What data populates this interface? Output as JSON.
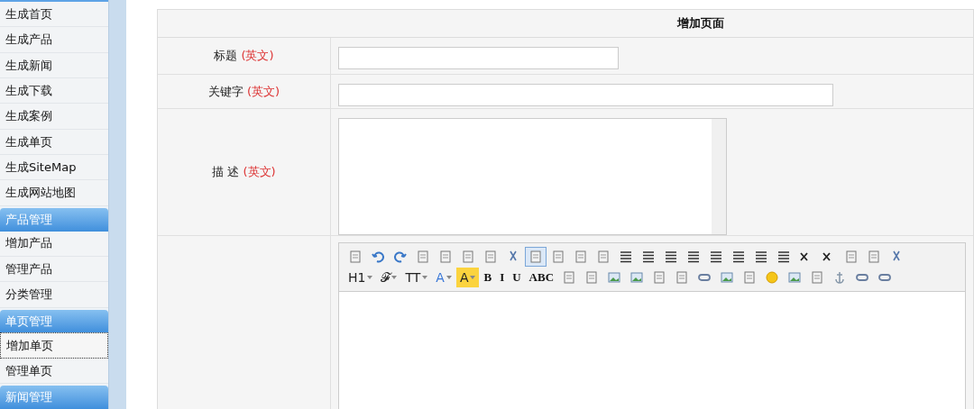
{
  "sidebar": {
    "items": [
      {
        "kind": "item",
        "label": "生成首页",
        "selected": false
      },
      {
        "kind": "item",
        "label": "生成产品",
        "selected": false
      },
      {
        "kind": "item",
        "label": "生成新闻",
        "selected": false
      },
      {
        "kind": "item",
        "label": "生成下载",
        "selected": false
      },
      {
        "kind": "item",
        "label": "生成案例",
        "selected": false
      },
      {
        "kind": "item",
        "label": "生成单页",
        "selected": false
      },
      {
        "kind": "item",
        "label": "生成SiteMap",
        "selected": false
      },
      {
        "kind": "item",
        "label": "生成网站地图",
        "selected": false
      },
      {
        "kind": "header",
        "label": "产品管理"
      },
      {
        "kind": "item",
        "label": "增加产品",
        "selected": false
      },
      {
        "kind": "item",
        "label": "管理产品",
        "selected": false
      },
      {
        "kind": "item",
        "label": "分类管理",
        "selected": false
      },
      {
        "kind": "header",
        "label": "单页管理"
      },
      {
        "kind": "item",
        "label": "增加单页",
        "selected": true
      },
      {
        "kind": "item",
        "label": "管理单页",
        "selected": false
      },
      {
        "kind": "header",
        "label": "新闻管理"
      }
    ]
  },
  "form": {
    "title": "增加页面",
    "fields": [
      {
        "kind": "short",
        "label": "标题",
        "note": "(英文)"
      },
      {
        "kind": "long",
        "label": "关键字",
        "note": "(英文)"
      },
      {
        "kind": "textarea",
        "label": "描 述",
        "note": "(英文)"
      }
    ],
    "toolbar": {
      "rows": [
        [
          {
            "kind": "icon",
            "selected": false
          },
          {
            "kind": "icon",
            "selected": false
          },
          {
            "kind": "icon",
            "selected": false
          },
          {
            "kind": "icon",
            "selected": false
          },
          {
            "kind": "icon",
            "selected": false
          },
          {
            "kind": "icon",
            "selected": false
          },
          {
            "kind": "icon",
            "selected": false
          },
          {
            "kind": "icon",
            "selected": false
          },
          {
            "kind": "icon",
            "selected": true
          },
          {
            "kind": "icon",
            "selected": false
          },
          {
            "kind": "icon",
            "selected": false
          },
          {
            "kind": "icon",
            "selected": false
          },
          {
            "kind": "icon",
            "selected": false
          },
          {
            "kind": "icon",
            "selected": false
          },
          {
            "kind": "icon",
            "selected": false
          },
          {
            "kind": "icon",
            "selected": false
          },
          {
            "kind": "icon",
            "selected": false
          },
          {
            "kind": "icon",
            "selected": false
          },
          {
            "kind": "icon",
            "selected": false
          },
          {
            "kind": "icon",
            "selected": false
          },
          {
            "kind": "icon",
            "selected": false
          },
          {
            "kind": "icon",
            "selected": false
          },
          {
            "kind": "icon",
            "selected": false
          },
          {
            "kind": "icon",
            "selected": false
          },
          {
            "kind": "icon",
            "selected": false
          }
        ],
        [
          {
            "kind": "menu",
            "label": "H1"
          },
          {
            "kind": "menu",
            "label": "𝓕"
          },
          {
            "kind": "menu",
            "label": "TT"
          },
          {
            "kind": "color",
            "label": "A"
          },
          {
            "kind": "highlight",
            "label": "A"
          },
          {
            "kind": "glyph",
            "label": "B"
          },
          {
            "kind": "glyph",
            "label": "I"
          },
          {
            "kind": "glyph",
            "label": "U"
          },
          {
            "kind": "glyph",
            "label": "ABC"
          },
          {
            "kind": "icon",
            "selected": false
          },
          {
            "kind": "icon",
            "selected": false
          },
          {
            "kind": "icon",
            "selected": false
          },
          {
            "kind": "icon",
            "selected": false
          },
          {
            "kind": "icon",
            "selected": false
          },
          {
            "kind": "icon",
            "selected": false
          },
          {
            "kind": "icon",
            "selected": false
          },
          {
            "kind": "icon",
            "selected": false
          },
          {
            "kind": "icon",
            "selected": false
          },
          {
            "kind": "icon",
            "selected": false
          },
          {
            "kind": "icon",
            "selected": false
          },
          {
            "kind": "icon",
            "selected": false
          },
          {
            "kind": "icon",
            "selected": false
          },
          {
            "kind": "icon",
            "selected": false
          },
          {
            "kind": "icon",
            "selected": false
          }
        ]
      ]
    }
  }
}
